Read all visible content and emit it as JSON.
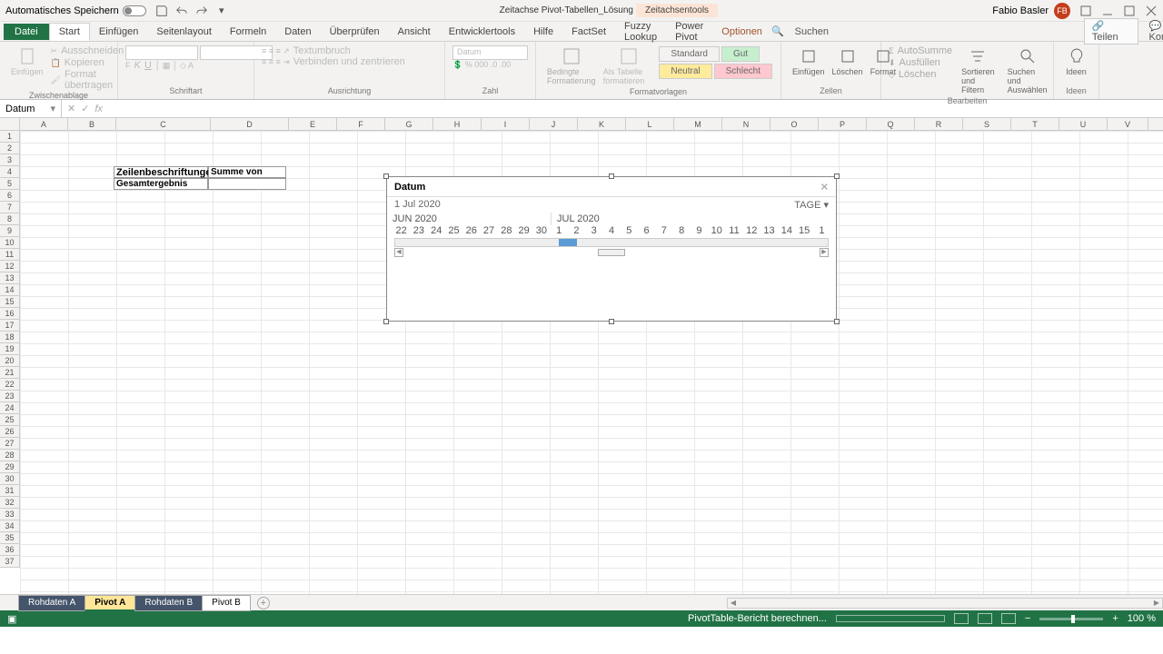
{
  "titlebar": {
    "autosave_label": "Automatisches Speichern",
    "doc_name": "Zeitachse Pivot-Tabellen_Lösung - Excel",
    "contextual_label": "Zeitachsentools",
    "user_name": "Fabio Basler",
    "user_initials": "FB"
  },
  "ribbon_tabs": {
    "file": "Datei",
    "list": [
      "Start",
      "Einfügen",
      "Seitenlayout",
      "Formeln",
      "Daten",
      "Überprüfen",
      "Ansicht",
      "Entwicklertools",
      "Hilfe",
      "FactSet",
      "Fuzzy Lookup",
      "Power Pivot",
      "Optionen"
    ],
    "active": "Start",
    "context": "Optionen",
    "search_placeholder": "Suchen",
    "share": "Teilen",
    "comments": "Kommentare"
  },
  "ribbon": {
    "clipboard": {
      "paste": "Einfügen",
      "cut": "Ausschneiden",
      "copy": "Kopieren",
      "format": "Format übertragen",
      "label": "Zwischenablage"
    },
    "font": {
      "label": "Schriftart"
    },
    "align": {
      "wrap": "Textumbruch",
      "merge": "Verbinden und zentrieren",
      "label": "Ausrichtung"
    },
    "number": {
      "combo": "Datum",
      "label": "Zahl"
    },
    "styles": {
      "cond": "Bedingte Formatierung",
      "table": "Als Tabelle formatieren",
      "s1": "Standard",
      "s2": "Gut",
      "s3": "Neutral",
      "s4": "Schlecht",
      "label": "Formatvorlagen"
    },
    "cells": {
      "insert": "Einfügen",
      "delete": "Löschen",
      "format": "Format",
      "label": "Zellen"
    },
    "editing": {
      "sum": "AutoSumme",
      "fill": "Ausfüllen",
      "clear": "Löschen",
      "sort": "Sortieren und Filtern",
      "find": "Suchen und Auswählen",
      "label": "Bearbeiten"
    },
    "ideas": {
      "btn": "Ideen",
      "label": "Ideen"
    }
  },
  "formula": {
    "name_box": "Datum"
  },
  "columns": [
    "A",
    "B",
    "C",
    "D",
    "E",
    "F",
    "G",
    "H",
    "I",
    "J",
    "K",
    "L",
    "M",
    "N",
    "O",
    "P",
    "Q",
    "R",
    "S",
    "T",
    "U",
    "V"
  ],
  "rows": [
    "1",
    "2",
    "3",
    "4",
    "5",
    "6",
    "7",
    "8",
    "9",
    "10",
    "11",
    "12",
    "13",
    "14",
    "15",
    "16",
    "17",
    "18",
    "19",
    "20",
    "21",
    "22",
    "23",
    "24",
    "25",
    "26",
    "27",
    "28",
    "29",
    "30",
    "31",
    "32",
    "33",
    "34",
    "35",
    "36",
    "37"
  ],
  "pivot": {
    "rowlabels": "Zeilenbeschriftungen",
    "sumof": "Summe von Umsatz",
    "grandtotal": "Gesamtergebnis"
  },
  "slicer": {
    "title": "Datum",
    "selected": "1 Jul 2020",
    "level": "TAGE",
    "month1": "JUN 2020",
    "month2": "JUL 2020",
    "days": [
      "22",
      "23",
      "24",
      "25",
      "26",
      "27",
      "28",
      "29",
      "30",
      "1",
      "2",
      "3",
      "4",
      "5",
      "6",
      "7",
      "8",
      "9",
      "10",
      "11",
      "12",
      "13",
      "14",
      "15",
      "1"
    ]
  },
  "sheets": {
    "list": [
      {
        "name": "Rohdaten A",
        "cls": "dark"
      },
      {
        "name": "Pivot A",
        "cls": "yellow active"
      },
      {
        "name": "Rohdaten B",
        "cls": "dark"
      },
      {
        "name": "Pivot B",
        "cls": ""
      }
    ]
  },
  "status": {
    "msg": "PivotTable-Bericht berechnen...",
    "zoom": "100 %"
  }
}
